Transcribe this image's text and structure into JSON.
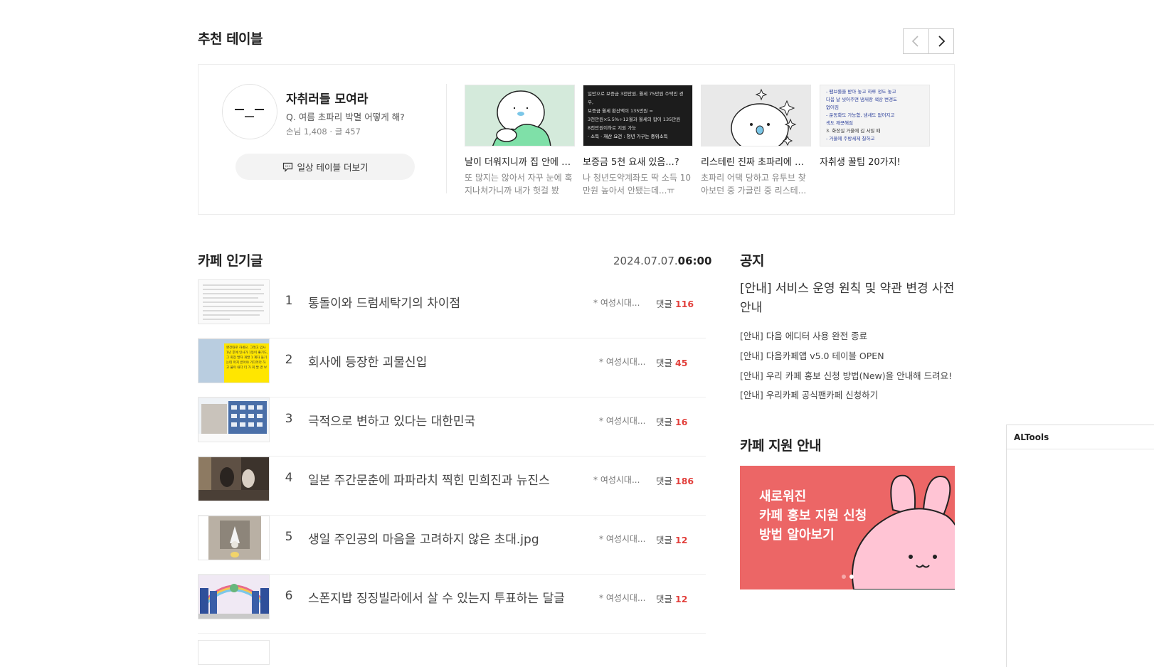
{
  "recommended": {
    "title": "추천 테이블",
    "table_name": "자취러들 모여라",
    "question": "Q. 여름 초파리 박멸 어떻게 해?",
    "stats": "손님 1,408 · 글 457",
    "more_button": "일상 테이블 더보기",
    "posts": [
      {
        "title": "날이 더워지니까 집 안에 날...",
        "desc": "또 많지는 않아서 자꾸 눈에 훅 지나쳐가니까 내가 헛걸 봤나..."
      },
      {
        "title": "보증금 5천 요새 있음...?",
        "desc": "나 청년도약계좌도 딱 소득 10만원 높아서 안됐는데...ㅠ"
      },
      {
        "title": "리스테린 진짜 초파리에 효...",
        "desc": "초파리 어택 당하고 유투브 찾아보던 중  가글린 중 리스테..."
      },
      {
        "title": "자취생 꿀팁 20가지!",
        "desc": ""
      }
    ],
    "thumb2_lines": [
      "일반으로 보증금 3천만원, 월세 75만원 주택인 경우,",
      "보증금 월세 환산액이 135만원 =",
      "3천만원×5.5%÷12월과 월세의 합이 135만원",
      "8천만원이하로 지원 가능",
      "· 소득 · 재산 요건 : 청년 가구는 중위소득"
    ],
    "thumb4_lines": [
      "- 팸브롤을 받아 놓고 하루 정도 놓고",
      "  다음 날 씻어주면 냄새랑 색상 변경도",
      "  없어짐",
      "- 운동화도 가능함, 냄새도 없어지고",
      "  색도 깨끗해짐",
      "3. 화장실 거울에 김 서릴 때",
      "- 거울에 주방세제 칠하고"
    ]
  },
  "popular": {
    "title": "카페 인기글",
    "time_date": "2024.07.07.",
    "time_hour": "06:00",
    "comment_label": "댓글",
    "rows": [
      {
        "num": "1",
        "title": "통돌이와 드럼세탁기의 차이점",
        "cafe": "* 여성시대...",
        "comments": "116"
      },
      {
        "num": "2",
        "title": "회사에 등장한 괴물신입",
        "cafe": "* 여성시대...",
        "comments": "45"
      },
      {
        "num": "3",
        "title": "극적으로 변하고 있다는 대한민국",
        "cafe": "* 여성시대...",
        "comments": "16"
      },
      {
        "num": "4",
        "title": "일본 주간문춘에 파파라치 찍힌 민희진과 뉴진스",
        "cafe": "* 여성시대...",
        "comments": "186"
      },
      {
        "num": "5",
        "title": "생일 주인공의 마음을 고려하지 않은 초대.jpg",
        "cafe": "* 여성시대...",
        "comments": "12"
      },
      {
        "num": "6",
        "title": "스폰지밥 징징빌라에서 살 수 있는지 투표하는 달글",
        "cafe": "* 여성시대...",
        "comments": "12"
      }
    ],
    "thumb2_text": "완전대로 하세요. 그래고 입사 1년 후에 인사가 1등이 좋기도, 그 회장 발자 개발 1 계차 들기는데 마지 받아야 기다려라 하고 불이 내다 더 가 회 발 경 보"
  },
  "notice": {
    "title": "공지",
    "main": "[안내] 서비스 운영 원칙 및 약관 변경 사전 안내",
    "items": [
      "[안내] 다음 에디터 사용 완전 종료",
      "[안내] 다음카페앱 v5.0 테이블 OPEN",
      "[안내] 우리 카페 홍보 신청 방법(New)을 안내해 드려요!",
      "[안내] 우리카페 공식팬카페 신청하기"
    ]
  },
  "support": {
    "title": "카페 지원 안내",
    "banner_lines": [
      "새로워진",
      "카페 홍보 지원 신청",
      "방법 알아보기"
    ]
  },
  "altools": {
    "title": "ALTools"
  },
  "colors": {
    "accent_red": "#e2403c",
    "banner": "#ec6666"
  }
}
